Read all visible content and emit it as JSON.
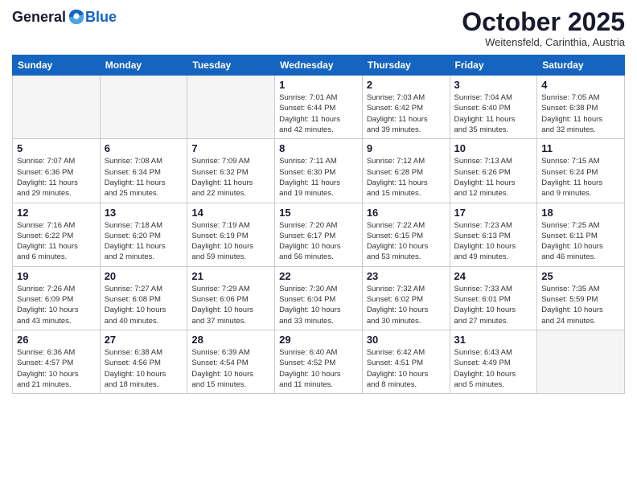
{
  "logo": {
    "general": "General",
    "blue": "Blue"
  },
  "header": {
    "month": "October 2025",
    "location": "Weitensfeld, Carinthia, Austria"
  },
  "days_of_week": [
    "Sunday",
    "Monday",
    "Tuesday",
    "Wednesday",
    "Thursday",
    "Friday",
    "Saturday"
  ],
  "weeks": [
    [
      {
        "day": "",
        "info": ""
      },
      {
        "day": "",
        "info": ""
      },
      {
        "day": "",
        "info": ""
      },
      {
        "day": "1",
        "info": "Sunrise: 7:01 AM\nSunset: 6:44 PM\nDaylight: 11 hours\nand 42 minutes."
      },
      {
        "day": "2",
        "info": "Sunrise: 7:03 AM\nSunset: 6:42 PM\nDaylight: 11 hours\nand 39 minutes."
      },
      {
        "day": "3",
        "info": "Sunrise: 7:04 AM\nSunset: 6:40 PM\nDaylight: 11 hours\nand 35 minutes."
      },
      {
        "day": "4",
        "info": "Sunrise: 7:05 AM\nSunset: 6:38 PM\nDaylight: 11 hours\nand 32 minutes."
      }
    ],
    [
      {
        "day": "5",
        "info": "Sunrise: 7:07 AM\nSunset: 6:36 PM\nDaylight: 11 hours\nand 29 minutes."
      },
      {
        "day": "6",
        "info": "Sunrise: 7:08 AM\nSunset: 6:34 PM\nDaylight: 11 hours\nand 25 minutes."
      },
      {
        "day": "7",
        "info": "Sunrise: 7:09 AM\nSunset: 6:32 PM\nDaylight: 11 hours\nand 22 minutes."
      },
      {
        "day": "8",
        "info": "Sunrise: 7:11 AM\nSunset: 6:30 PM\nDaylight: 11 hours\nand 19 minutes."
      },
      {
        "day": "9",
        "info": "Sunrise: 7:12 AM\nSunset: 6:28 PM\nDaylight: 11 hours\nand 15 minutes."
      },
      {
        "day": "10",
        "info": "Sunrise: 7:13 AM\nSunset: 6:26 PM\nDaylight: 11 hours\nand 12 minutes."
      },
      {
        "day": "11",
        "info": "Sunrise: 7:15 AM\nSunset: 6:24 PM\nDaylight: 11 hours\nand 9 minutes."
      }
    ],
    [
      {
        "day": "12",
        "info": "Sunrise: 7:16 AM\nSunset: 6:22 PM\nDaylight: 11 hours\nand 6 minutes."
      },
      {
        "day": "13",
        "info": "Sunrise: 7:18 AM\nSunset: 6:20 PM\nDaylight: 11 hours\nand 2 minutes."
      },
      {
        "day": "14",
        "info": "Sunrise: 7:19 AM\nSunset: 6:19 PM\nDaylight: 10 hours\nand 59 minutes."
      },
      {
        "day": "15",
        "info": "Sunrise: 7:20 AM\nSunset: 6:17 PM\nDaylight: 10 hours\nand 56 minutes."
      },
      {
        "day": "16",
        "info": "Sunrise: 7:22 AM\nSunset: 6:15 PM\nDaylight: 10 hours\nand 53 minutes."
      },
      {
        "day": "17",
        "info": "Sunrise: 7:23 AM\nSunset: 6:13 PM\nDaylight: 10 hours\nand 49 minutes."
      },
      {
        "day": "18",
        "info": "Sunrise: 7:25 AM\nSunset: 6:11 PM\nDaylight: 10 hours\nand 46 minutes."
      }
    ],
    [
      {
        "day": "19",
        "info": "Sunrise: 7:26 AM\nSunset: 6:09 PM\nDaylight: 10 hours\nand 43 minutes."
      },
      {
        "day": "20",
        "info": "Sunrise: 7:27 AM\nSunset: 6:08 PM\nDaylight: 10 hours\nand 40 minutes."
      },
      {
        "day": "21",
        "info": "Sunrise: 7:29 AM\nSunset: 6:06 PM\nDaylight: 10 hours\nand 37 minutes."
      },
      {
        "day": "22",
        "info": "Sunrise: 7:30 AM\nSunset: 6:04 PM\nDaylight: 10 hours\nand 33 minutes."
      },
      {
        "day": "23",
        "info": "Sunrise: 7:32 AM\nSunset: 6:02 PM\nDaylight: 10 hours\nand 30 minutes."
      },
      {
        "day": "24",
        "info": "Sunrise: 7:33 AM\nSunset: 6:01 PM\nDaylight: 10 hours\nand 27 minutes."
      },
      {
        "day": "25",
        "info": "Sunrise: 7:35 AM\nSunset: 5:59 PM\nDaylight: 10 hours\nand 24 minutes."
      }
    ],
    [
      {
        "day": "26",
        "info": "Sunrise: 6:36 AM\nSunset: 4:57 PM\nDaylight: 10 hours\nand 21 minutes."
      },
      {
        "day": "27",
        "info": "Sunrise: 6:38 AM\nSunset: 4:56 PM\nDaylight: 10 hours\nand 18 minutes."
      },
      {
        "day": "28",
        "info": "Sunrise: 6:39 AM\nSunset: 4:54 PM\nDaylight: 10 hours\nand 15 minutes."
      },
      {
        "day": "29",
        "info": "Sunrise: 6:40 AM\nSunset: 4:52 PM\nDaylight: 10 hours\nand 11 minutes."
      },
      {
        "day": "30",
        "info": "Sunrise: 6:42 AM\nSunset: 4:51 PM\nDaylight: 10 hours\nand 8 minutes."
      },
      {
        "day": "31",
        "info": "Sunrise: 6:43 AM\nSunset: 4:49 PM\nDaylight: 10 hours\nand 5 minutes."
      },
      {
        "day": "",
        "info": ""
      }
    ]
  ]
}
